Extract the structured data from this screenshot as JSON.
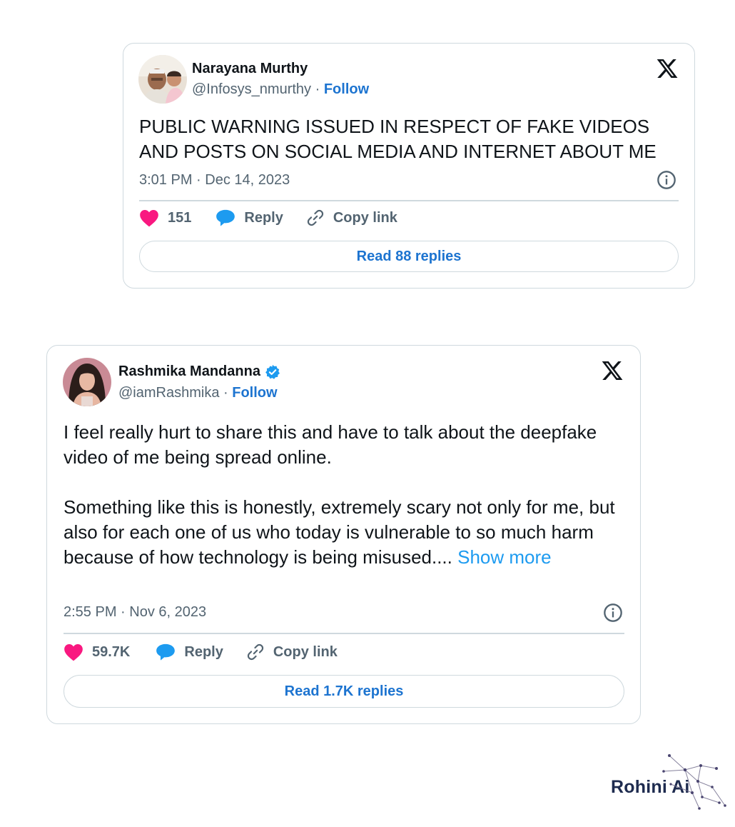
{
  "tweets": [
    {
      "author": {
        "name": "Narayana Murthy",
        "handle": "@Infosys_nmurthy",
        "verified": false
      },
      "follow_label": "Follow",
      "separator": "·",
      "text": [
        "PUBLIC WARNING ISSUED IN RESPECT OF FAKE VIDEOS AND POSTS ON SOCIAL MEDIA AND INTERNET ABOUT ME"
      ],
      "timestamp": "3:01 PM · Dec 14, 2023",
      "likes": "151",
      "reply_label": "Reply",
      "copy_link_label": "Copy link",
      "read_replies_label": "Read 88 replies"
    },
    {
      "author": {
        "name": "Rashmika Mandanna",
        "handle": "@iamRashmika",
        "verified": true
      },
      "follow_label": "Follow",
      "separator": "·",
      "text": [
        "I feel really hurt to share this and have to talk about the deepfake video of me being spread online.",
        "Something like this is honestly, extremely scary not only for me, but also for each one of us who today is vulnerable to so much harm because of how technology is being misused...."
      ],
      "show_more_label": "Show more",
      "timestamp": "2:55 PM · Nov 6, 2023",
      "likes": "59.7K",
      "reply_label": "Reply",
      "copy_link_label": "Copy link",
      "read_replies_label": "Read 1.7K replies"
    }
  ],
  "brand": {
    "label": "Rohini Ai"
  },
  "icons": {
    "platform": "x-logo-icon",
    "like": "heart-icon",
    "reply": "speech-bubble-icon",
    "copy": "link-icon",
    "info": "info-icon",
    "verified": "verified-badge-icon"
  },
  "colors": {
    "link_blue": "#1d74d0",
    "show_more_blue": "#1d9bf0",
    "heart_pink": "#f91880",
    "reply_blue": "#1d9bf0",
    "verified_blue": "#1d9bf0",
    "muted_gray": "#536471",
    "border": "#cfd9de"
  }
}
